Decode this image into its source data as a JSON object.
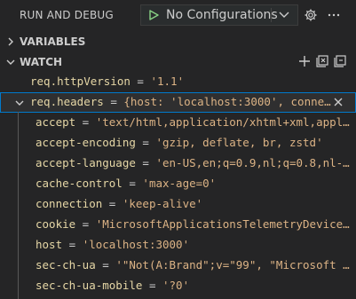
{
  "header": {
    "title": "RUN AND DEBUG",
    "config_label": "No Configurations"
  },
  "sections": {
    "variables": "VARIABLES",
    "watch": "WATCH"
  },
  "watch": {
    "expr1": {
      "name": "req.httpVersion",
      "eq": " = ",
      "value": "'1.1'"
    },
    "expr2": {
      "name": "req.headers",
      "eq": " = ",
      "value": "{host: 'localhost:3000', conne…"
    },
    "children": [
      {
        "name": "accept",
        "eq": " = ",
        "value": "'text/html,application/xhtml+xml,appl…"
      },
      {
        "name": "accept-encoding",
        "eq": " = ",
        "value": "'gzip, deflate, br, zstd'"
      },
      {
        "name": "accept-language",
        "eq": " = ",
        "value": "'en-US,en;q=0.9,nl;q=0.8,nl-…"
      },
      {
        "name": "cache-control",
        "eq": " = ",
        "value": "'max-age=0'"
      },
      {
        "name": "connection",
        "eq": " = ",
        "value": "'keep-alive'"
      },
      {
        "name": "cookie",
        "eq": " = ",
        "value": "'MicrosoftApplicationsTelemetryDevice…"
      },
      {
        "name": "host",
        "eq": " = ",
        "value": "'localhost:3000'"
      },
      {
        "name": "sec-ch-ua",
        "eq": " = ",
        "value": "'\"Not(A:Brand\";v=\"99\", \"Microsoft …"
      },
      {
        "name": "sec-ch-ua-mobile",
        "eq": " = ",
        "value": "'?0'"
      }
    ]
  },
  "colors": {
    "background": "#252526",
    "accent": "#007acc",
    "play_green": "#89d185",
    "name": "#e6d7a6",
    "value": "#dcb385"
  },
  "icons": [
    "play-icon",
    "chevron-down-icon",
    "gear-icon",
    "more-icon",
    "chevron-right-icon",
    "add-icon",
    "collapse-all-icon",
    "remove-all-icon",
    "close-icon"
  ]
}
